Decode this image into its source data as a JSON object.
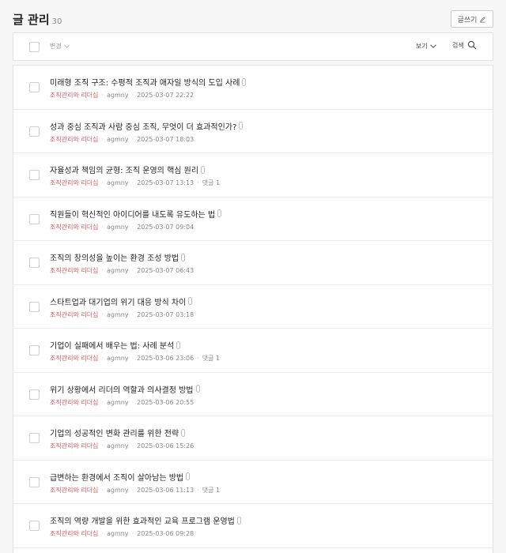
{
  "header": {
    "title": "글 관리",
    "count": "30",
    "write_label": "글쓰기"
  },
  "toolbar": {
    "change_label": "변경",
    "view_label": "보기",
    "search_label": "검색"
  },
  "posts": [
    {
      "title": "미래형 조직 구조: 수평적 조직과 애자일 방식의 도입 사례",
      "category": "조직관리와 리더십",
      "author": "agmny",
      "date": "2025-03-07 22:22",
      "comments": ""
    },
    {
      "title": "성과 중심 조직과 사람 중심 조직, 무엇이 더 효과적인가?",
      "category": "조직관리와 리더십",
      "author": "agmny",
      "date": "2025-03-07 18:03",
      "comments": ""
    },
    {
      "title": "자율성과 책임의 균형: 조직 운영의 핵심 원리",
      "category": "조직관리와 리더십",
      "author": "agmny",
      "date": "2025-03-07 13:13",
      "comments": "댓글 1"
    },
    {
      "title": "직원들이 혁신적인 아이디어를 내도록 유도하는 법",
      "category": "조직관리와 리더십",
      "author": "agmny",
      "date": "2025-03-07 09:04",
      "comments": ""
    },
    {
      "title": "조직의 창의성을 높이는 환경 조성 방법",
      "category": "조직관리와 리더십",
      "author": "agmny",
      "date": "2025-03-07 06:43",
      "comments": ""
    },
    {
      "title": "스타트업과 대기업의 위기 대응 방식 차이",
      "category": "조직관리와 리더십",
      "author": "agmny",
      "date": "2025-03-07 03:18",
      "comments": ""
    },
    {
      "title": "기업이 실패에서 배우는 법: 사례 분석",
      "category": "조직관리와 리더십",
      "author": "agmny",
      "date": "2025-03-06 23:06",
      "comments": "댓글 1"
    },
    {
      "title": "위기 상황에서 리더의 역할과 의사결정 방법",
      "category": "조직관리와 리더십",
      "author": "agmny",
      "date": "2025-03-06 20:55",
      "comments": ""
    },
    {
      "title": "기업의 성공적인 변화 관리를 위한 전략",
      "category": "조직관리와 리더십",
      "author": "agmny",
      "date": "2025-03-06 15:26",
      "comments": ""
    },
    {
      "title": "급변하는 환경에서 조직이 살아남는 방법",
      "category": "조직관리와 리더십",
      "author": "agmny",
      "date": "2025-03-06 11:13",
      "comments": "댓글 1"
    },
    {
      "title": "조직의 역량 개발을 위한 효과적인 교육 프로그램 운영법",
      "category": "조직관리와 리더십",
      "author": "agmny",
      "date": "2025-03-06 09:28",
      "comments": ""
    }
  ]
}
